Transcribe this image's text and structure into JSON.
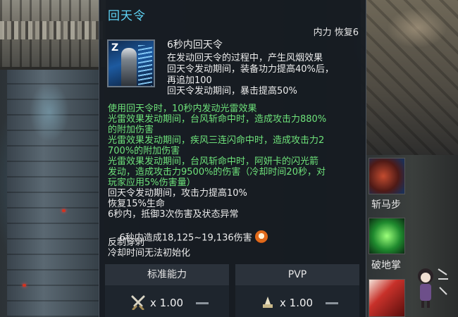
{
  "skill": {
    "title": "回天令",
    "cost": "内力 恢复6",
    "icon": "huitianling-skill-icon",
    "icon_letter": "Z"
  },
  "description": {
    "heading": "6秒内回天令",
    "lines": [
      "在发动回天令的过程中，产生风烟效果",
      "回天令发动期间，装备功力提高40%后，",
      "再追加100",
      "回天令发动期间，暴击提高50%"
    ]
  },
  "effects_green": [
    "使用回天令时，10秒内发动光雷效果",
    "光雷效果发动期间，台风斩命中时，造成攻击力880%",
    "的附加伤害",
    "光雷效果发动期间，疾风三连闪命中时，造成攻击力2",
    "700%的附加伤害",
    "光雷效果发动期间，台风斩命中时，阿妍卡的闪光箭",
    "发动，造成攻击力9500%的伤害（冷却时间20秒，对",
    "玩家应用5%伤害量）"
  ],
  "effects_white": [
    "回天令发动期间，攻击力提高10%",
    "恢复15%生命",
    "6秒内，抵御3次伤害及状态异常",
    "6秒内造成18,125~19,136伤害"
  ],
  "extra": [
    "反制穿刺",
    "冷却时间无法初始化"
  ],
  "stats": {
    "standard_label": "标准能力",
    "pvp_label": "PVP",
    "standard_value": "x 1.00",
    "pvp_value": "x 1.00"
  },
  "side_skills": [
    {
      "label": "斩马步"
    },
    {
      "label": "破地掌"
    }
  ],
  "colors": {
    "title": "#5fd3f5",
    "green_text": "#6ee27a",
    "body_text": "#ececec"
  }
}
